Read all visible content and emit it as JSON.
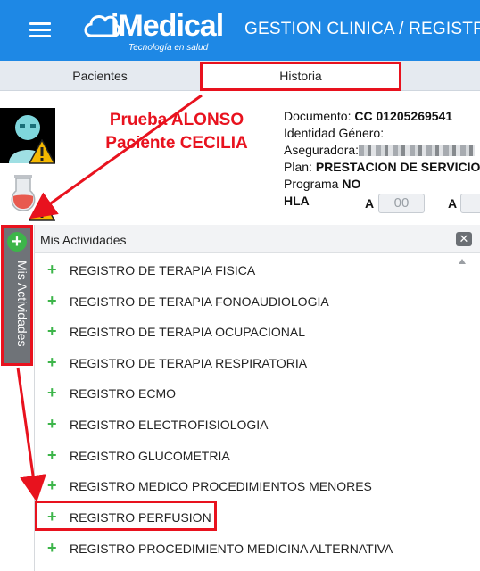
{
  "header": {
    "logo_text": "iMedical",
    "logo_tagline": "Tecnología en salud",
    "breadcrumb": "GESTION CLINICA  /  REGISTRO"
  },
  "tabs": [
    {
      "label": "Pacientes"
    },
    {
      "label": "Historia",
      "active": true
    }
  ],
  "patient": {
    "name_line1": "Prueba ALONSO",
    "name_line2": "Paciente CECILIA",
    "documento_label": "Documento:",
    "documento_value": "CC 01205269541",
    "identidad_label": "Identidad Género:",
    "aseguradora_label": "Aseguradora:",
    "plan_label": "Plan:",
    "plan_value": "PRESTACION DE SERVICIO",
    "programa_label": "Programa",
    "programa_value": "NO",
    "hla_label": "HLA",
    "hla_a1_label": "A",
    "hla_a1_value": "00",
    "hla_a2_label": "A"
  },
  "sidebar_tab": {
    "label": "Mis Actividades"
  },
  "panel": {
    "title": "Mis Actividades",
    "items": [
      {
        "label": "REGISTRO DE TERAPIA FISICA"
      },
      {
        "label": "REGISTRO DE TERAPIA FONOAUDIOLOGIA"
      },
      {
        "label": "REGISTRO DE TERAPIA OCUPACIONAL"
      },
      {
        "label": "REGISTRO DE TERAPIA RESPIRATORIA"
      },
      {
        "label": "REGISTRO ECMO"
      },
      {
        "label": "REGISTRO ELECTROFISIOLOGIA"
      },
      {
        "label": "REGISTRO GLUCOMETRIA"
      },
      {
        "label": "REGISTRO MEDICO PROCEDIMIENTOS MENORES"
      },
      {
        "label": "REGISTRO PERFUSION",
        "highlighted": true
      },
      {
        "label": "REGISTRO PROCEDIMIENTO MEDICINA ALTERNATIVA"
      }
    ]
  },
  "colors": {
    "header_bg": "#1e88e5",
    "highlight": "#e8121e",
    "plus_green": "#3db54a",
    "side_tab_bg": "#6f7378"
  },
  "icons": {
    "menu": "hamburger-icon",
    "avatar": "patient-avatar-icon",
    "warning": "warning-icon",
    "lab": "lab-flask-icon",
    "add": "plus-icon",
    "close": "close-icon"
  }
}
